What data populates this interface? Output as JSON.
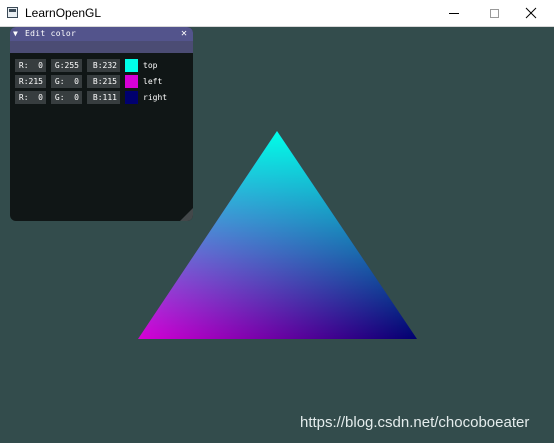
{
  "window": {
    "title": "LearnOpenGL",
    "icons": [
      "app-icon",
      "minimize-icon",
      "maximize-icon",
      "close-icon"
    ]
  },
  "viewport": {
    "background": "#334c4c"
  },
  "imgui": {
    "title": "Edit color",
    "collapse_glyph": "▼",
    "close_glyph": "✕",
    "rows": [
      {
        "label": "top",
        "r": "R:  0",
        "g": "G:255",
        "b": "B:232",
        "color": "#00ffe8"
      },
      {
        "label": "left",
        "r": "R:215",
        "g": "G:  0",
        "b": "B:215",
        "color": "#d700d7"
      },
      {
        "label": "right",
        "r": "R:  0",
        "g": "G:  0",
        "b": "B:111",
        "color": "#00006f"
      }
    ]
  },
  "triangle": {
    "top_color": "#00ffe8",
    "left_color": "#d700d7",
    "right_color": "#00006f"
  },
  "watermark": "https://blog.csdn.net/chocoboeater"
}
